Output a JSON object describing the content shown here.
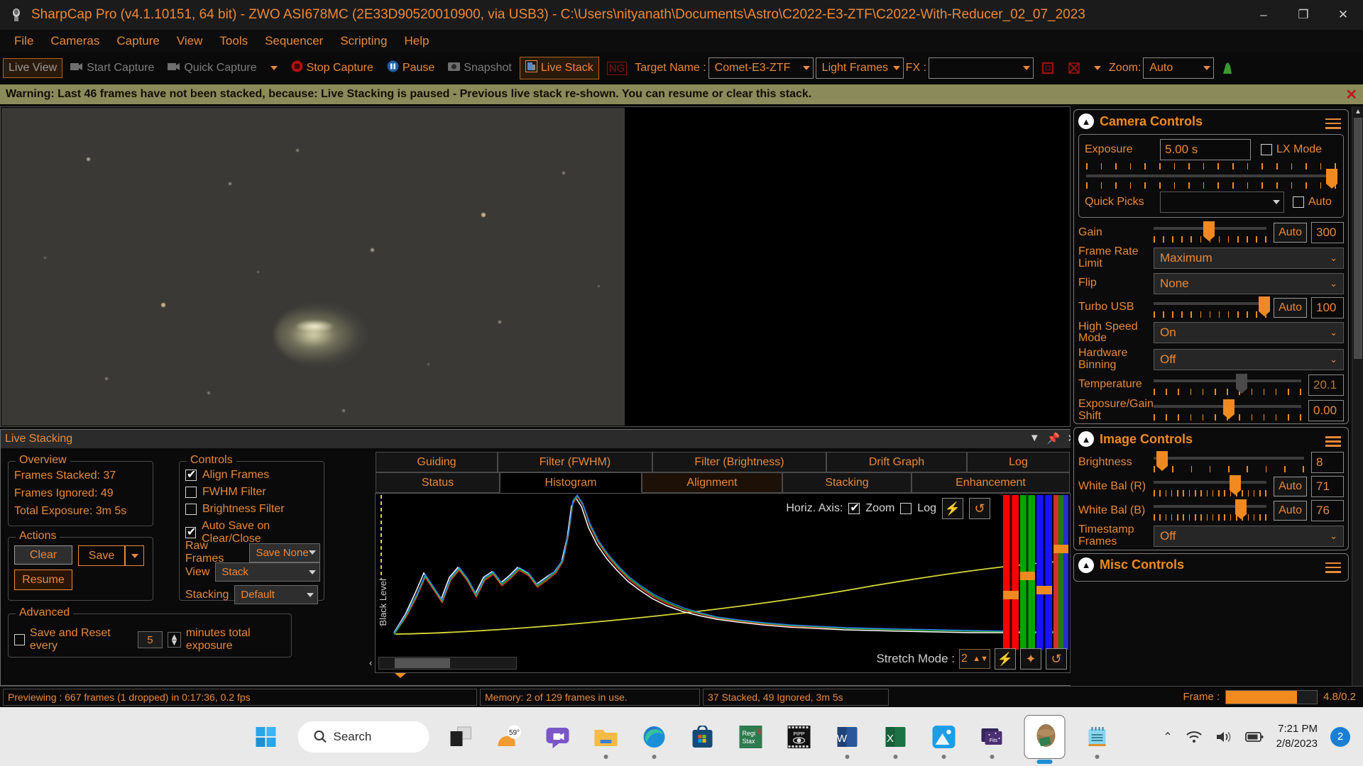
{
  "window": {
    "title": "SharpCap Pro (v4.1.10151, 64 bit) - ZWO ASI678MC (2E33D90520010900, via USB3) - C:\\Users\\nityanath\\Documents\\Astro\\C2022-E3-ZTF\\C2022-With-Reducer_02_07_2023",
    "minimize": "–",
    "maximize": "❐",
    "close": "✕"
  },
  "menu": {
    "items": [
      "File",
      "Cameras",
      "Capture",
      "View",
      "Tools",
      "Sequencer",
      "Scripting",
      "Help"
    ]
  },
  "toolbar": {
    "live_view": "Live View",
    "start_capture": "Start Capture",
    "quick_capture": "Quick Capture",
    "stop_capture": "Stop Capture",
    "pause": "Pause",
    "snapshot": "Snapshot",
    "live_stack": "Live Stack",
    "target_name_label": "Target Name :",
    "target_name_value": "Comet-E3-ZTF",
    "frame_type_value": "Light Frames",
    "fx_label": "FX :",
    "fx_value": "",
    "zoom_label": "Zoom:",
    "zoom_value": "Auto"
  },
  "warning": {
    "text": "Warning: Last 46 frames have not been stacked, because: Live Stacking is paused - Previous live stack re-shown. You can resume or clear this stack.",
    "close": "✕"
  },
  "live_stacking": {
    "panel_title": "Live Stacking",
    "overview_label": "Overview",
    "frames_stacked": "Frames Stacked: 37",
    "frames_ignored": "Frames Ignored: 49",
    "total_exposure": "Total Exposure:   3m 5s",
    "actions_label": "Actions",
    "clear_button": "Clear",
    "save_button": "Save",
    "resume_button": "Resume",
    "advanced_label": "Advanced",
    "save_reset_label": "Save and Reset every",
    "save_reset_value": "5",
    "save_reset_suffix": "minutes total exposure",
    "controls_label": "Controls",
    "align_frames": "Align Frames",
    "fwhm_filter": "FWHM Filter",
    "brightness_filter": "Brightness Filter",
    "auto_save": "Auto Save on Clear/Close",
    "raw_frames_label": "Raw Frames",
    "raw_frames_value": "Save None",
    "view_label": "View",
    "view_value": "Stack",
    "stacking_label": "Stacking",
    "stacking_value": "Default"
  },
  "tabs": {
    "row1": [
      "Guiding",
      "Filter (FWHM)",
      "Filter (Brightness)",
      "Drift Graph",
      "Log"
    ],
    "row2": [
      "Status",
      "Histogram",
      "Alignment",
      "Stacking",
      "Enhancement"
    ],
    "selected": "Histogram"
  },
  "histogram": {
    "horiz_axis_label": "Horiz. Axis:",
    "zoom_label": "Zoom",
    "log_label": "Log",
    "black_level_label": "Black Level",
    "stretch_mode_label": "Stretch Mode :",
    "stretch_mode_value": "2",
    "bolt_icon": "⚡",
    "reset_icon": "↺",
    "star_icon": "✦"
  },
  "chart_data": {
    "type": "line",
    "title": "Histogram",
    "xlabel": "",
    "ylabel": "",
    "series": [
      {
        "name": "Red",
        "color": "#ff2b2b"
      },
      {
        "name": "Green",
        "color": "#19c219"
      },
      {
        "name": "Blue",
        "color": "#2b7bff"
      },
      {
        "name": "Luminance",
        "color": "#ffffff"
      },
      {
        "name": "Stretch Curve",
        "color": "#d8d83a"
      }
    ],
    "legend": "none",
    "grid": false
  },
  "camera_controls": {
    "title": "Camera Controls",
    "exposure_label": "Exposure",
    "exposure_value": "5.00 s",
    "lx_mode": "LX Mode",
    "quick_picks_label": "Quick Picks",
    "quick_picks_value": "",
    "auto_label": "Auto",
    "gain_label": "Gain",
    "gain_auto": "Auto",
    "gain_value": "300",
    "frame_rate_label": "Frame Rate Limit",
    "frame_rate_value": "Maximum",
    "flip_label": "Flip",
    "flip_value": "None",
    "turbo_usb_label": "Turbo USB",
    "turbo_usb_auto": "Auto",
    "turbo_usb_value": "100",
    "high_speed_label": "High Speed Mode",
    "high_speed_value": "On",
    "hw_binning_label": "Hardware Binning",
    "hw_binning_value": "Off",
    "temperature_label": "Temperature",
    "temperature_value": "20.1",
    "exp_gain_shift_label": "Exposure/Gain Shift",
    "exp_gain_shift_value": "0.00"
  },
  "image_controls": {
    "title": "Image Controls",
    "brightness_label": "Brightness",
    "brightness_value": "8",
    "wb_r_label": "White Bal (R)",
    "wb_r_auto": "Auto",
    "wb_r_value": "71",
    "wb_b_label": "White Bal (B)",
    "wb_b_auto": "Auto",
    "wb_b_value": "76",
    "timestamp_label": "Timestamp Frames",
    "timestamp_value": "Off"
  },
  "misc_controls": {
    "title": "Misc Controls"
  },
  "status_bar": {
    "preview": "Previewing : 667 frames (1 dropped) in 0:17:36, 0.2 fps",
    "memory": "Memory: 2 of 129 frames in use.",
    "stack": "37 Stacked, 49 Ignored, 3m 5s",
    "frame_label": "Frame :",
    "frame_value": "4.8/0.2",
    "frame_percent": 78
  },
  "taskbar": {
    "search_placeholder": "Search",
    "weather": "59°",
    "time": "7:21 PM",
    "date": "2/8/2023",
    "notification_count": "2"
  },
  "colors": {
    "accent": "#e8893a",
    "accent_bright": "#f08a20",
    "warning_bg": "#8a8a5a",
    "panel_bg": "#0a0a0a"
  }
}
